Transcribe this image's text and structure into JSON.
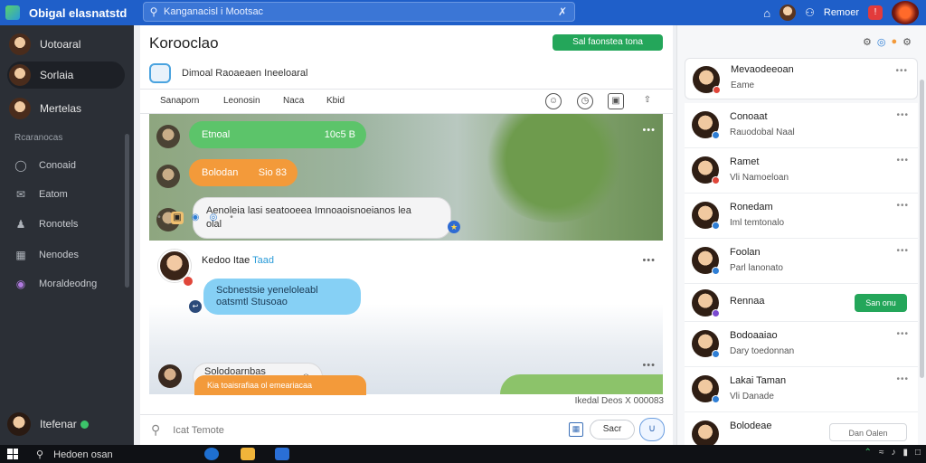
{
  "app": {
    "title": "Obigal elasnatstd"
  },
  "search": {
    "placeholder": "Kanganacisl i Mootsac"
  },
  "topbar": {
    "user_name": "Remoer",
    "notification_count": "!"
  },
  "sidebar": {
    "items": [
      {
        "label": "Uotoaral"
      },
      {
        "label": "Sorlaia"
      },
      {
        "label": "Mertelas"
      }
    ],
    "section_label": "Rcaranocas",
    "nav": [
      {
        "label": "Conoaid",
        "icon": "circle-icon"
      },
      {
        "label": "Eatom",
        "icon": "chat-icon"
      },
      {
        "label": "Ronotels",
        "icon": "person-icon"
      },
      {
        "label": "Nenodes",
        "icon": "grid-icon"
      },
      {
        "label": "Moraldeodng",
        "icon": "badge-icon"
      }
    ],
    "user": {
      "label": "Itefenar"
    }
  },
  "main": {
    "title": "Korooclao",
    "primary_button": "Sal faonstea tona",
    "subtitle": "Dimoal  Raoaeaen Ineeloaral",
    "tabs": [
      "Sanaporn",
      "Leonosin",
      "Naca",
      "Kbid"
    ],
    "messages": [
      {
        "text": "Etnoal",
        "meta": "10c5 B"
      },
      {
        "text": "Bolodan",
        "meta": "Sio 83"
      },
      {
        "text": "Aenoleia lasi seatooeea Imnoaoisnoeianos lea olal"
      },
      {
        "sender": "Kedoo Itae",
        "sender_highlight": "Taad"
      },
      {
        "text": "Scbnestsie yeneloleabl oatsmtl Stusoao"
      },
      {
        "text": "Solodoarnbas peseal."
      },
      {
        "text": "Kia toaisrafiaa ol emeariacaa"
      }
    ],
    "timestamp": "Ikedal Deos X 000083",
    "composer": {
      "placeholder": "Icat Temote",
      "send": "Sacr"
    }
  },
  "right_panel": {
    "header_card": {
      "name": "Mevaodeeoan",
      "sub": "Eame"
    },
    "contacts": [
      {
        "name": "Conoaat",
        "sub": "Rauodobal  Naal"
      },
      {
        "name": "Ramet",
        "sub": "Vli  Namoeloan"
      },
      {
        "name": "Ronedam",
        "sub": "Iml temtonalo"
      },
      {
        "name": "Foolan",
        "sub": "Parl lanonato"
      },
      {
        "name": "Rennaa",
        "button": "San onu"
      },
      {
        "name": "Bodoaaiao",
        "sub": "Dary toedonnan"
      },
      {
        "name": "Lakai Taman",
        "sub": "Vli  Danade"
      },
      {
        "name": "Bolodeae",
        "button": "Dan Oalen"
      }
    ]
  },
  "taskbar": {
    "search_label": "Hedoen osan"
  }
}
